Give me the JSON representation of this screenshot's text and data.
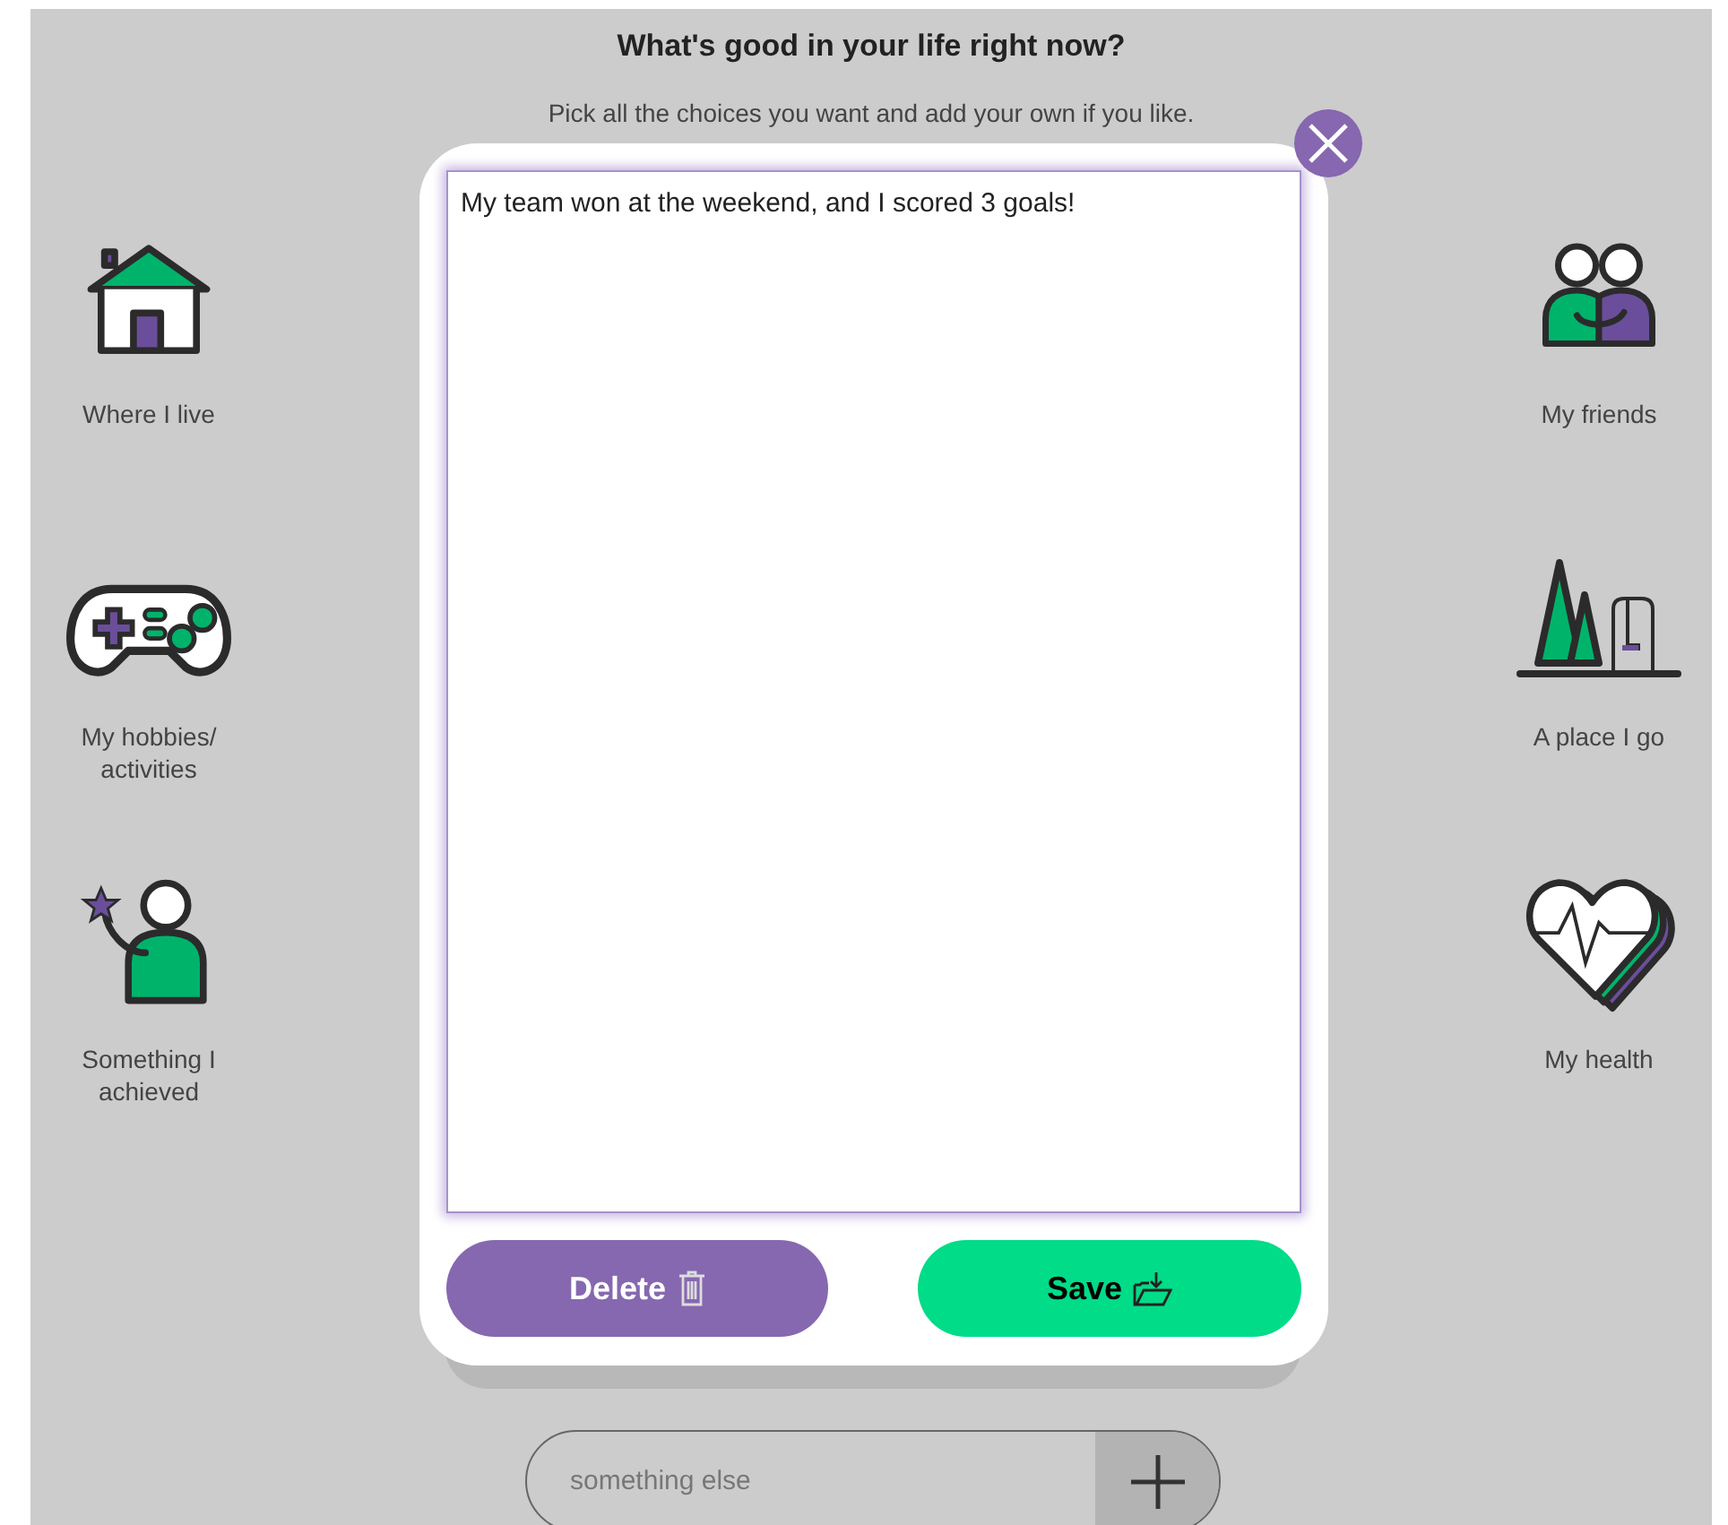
{
  "header": {
    "title": "What's good in your life right now?",
    "subtitle": "Pick all the choices you want and add your own if you like."
  },
  "choices_left": [
    {
      "kind": "house",
      "label": "Where I live"
    },
    {
      "kind": "gamepad",
      "label": "My hobbies/ activities"
    },
    {
      "kind": "achiever",
      "label": "Something I achieved"
    }
  ],
  "choices_right": [
    {
      "kind": "friends",
      "label": "My friends"
    },
    {
      "kind": "park",
      "label": "A place I go"
    },
    {
      "kind": "heart",
      "label": "My health"
    }
  ],
  "dialog": {
    "text": "My team won at the weekend, and I scored 3 goals!",
    "buttons": [
      {
        "kind": "delete",
        "label": "Delete"
      },
      {
        "kind": "save",
        "label": "Save"
      }
    ]
  },
  "add_field": {
    "placeholder": "something else"
  }
}
